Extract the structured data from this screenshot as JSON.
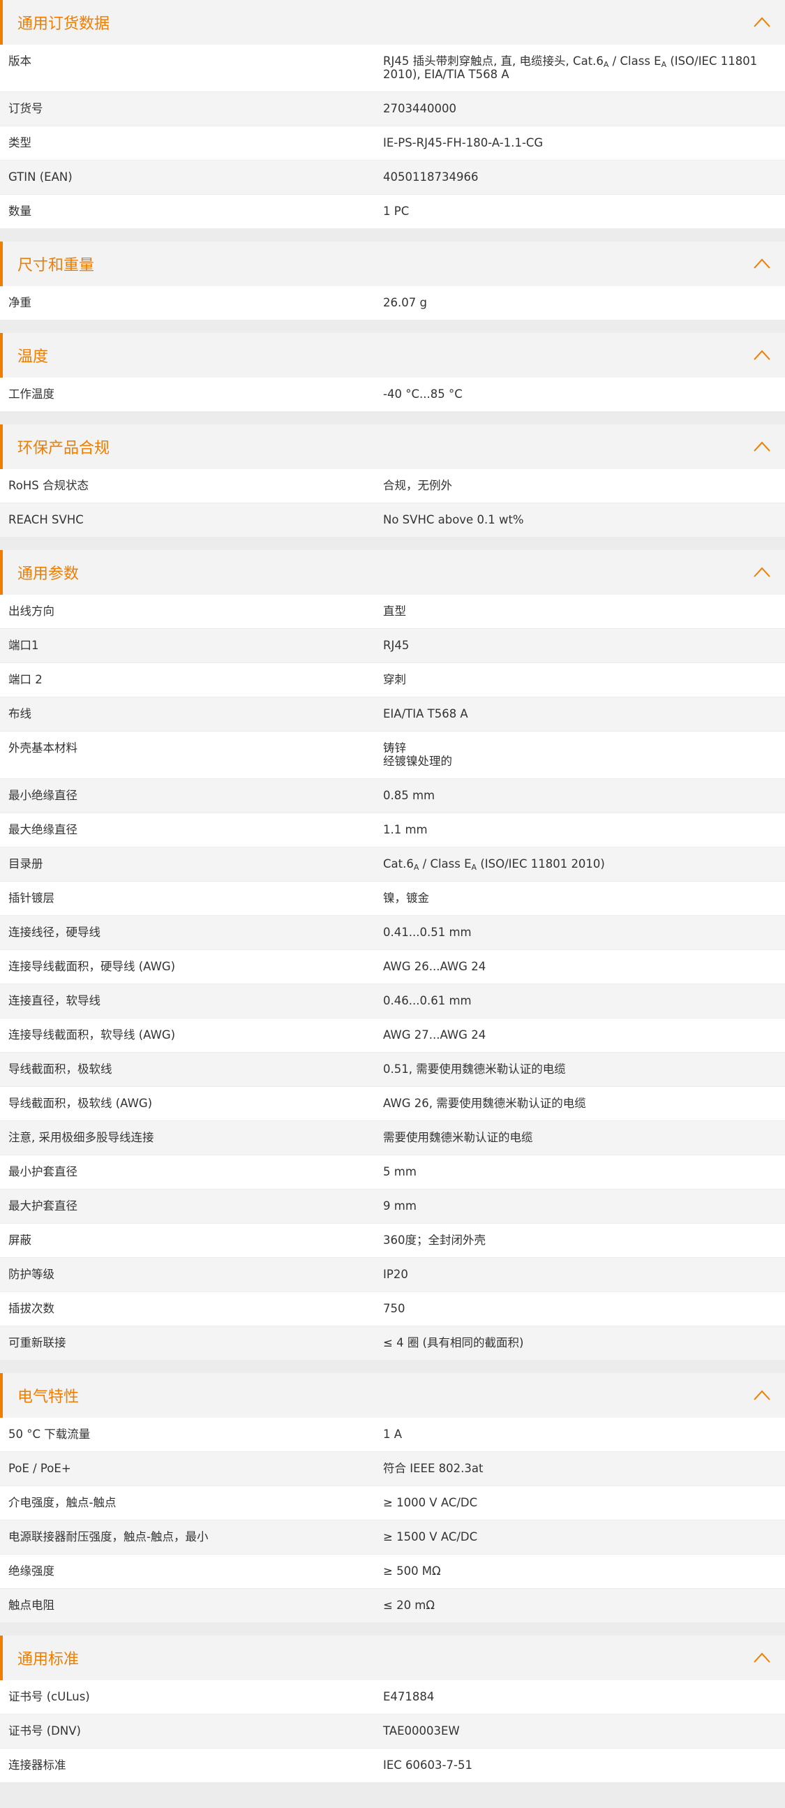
{
  "accent_color": "#f07d00",
  "collapse_icon": "chevron-up-icon",
  "sections": [
    {
      "id": "general-order",
      "title": "通用订货数据",
      "rows": [
        {
          "label": "版本",
          "value": "RJ45 插头带刺穿触点, 直, 电缆接头, Cat.6A / Class EA (ISO/IEC 11801 2010), EIA/TIA T568 A"
        },
        {
          "label": "订货号",
          "value": "2703440000"
        },
        {
          "label": "类型",
          "value": "IE-PS-RJ45-FH-180-A-1.1-CG"
        },
        {
          "label": "GTIN (EAN)",
          "value": "4050118734966"
        },
        {
          "label": "数量",
          "value": "1  PC"
        }
      ]
    },
    {
      "id": "dimensions",
      "title": "尺寸和重量",
      "rows": [
        {
          "label": "净重",
          "value": "26.07  g"
        }
      ]
    },
    {
      "id": "temperature",
      "title": "温度",
      "rows": [
        {
          "label": "工作温度",
          "value": "-40 °C...85 °C"
        }
      ]
    },
    {
      "id": "compliance",
      "title": "环保产品合规",
      "rows": [
        {
          "label": "RoHS 合规状态",
          "value": "合规，无例外"
        },
        {
          "label": "REACH SVHC",
          "value": "No SVHC above 0.1 wt%"
        }
      ]
    },
    {
      "id": "general-params",
      "title": "通用参数",
      "rows": [
        {
          "label": "出线方向",
          "value": "直型"
        },
        {
          "label": "端口1",
          "value": "RJ45"
        },
        {
          "label": "端口 2",
          "value": "穿刺"
        },
        {
          "label": "布线",
          "value": "EIA/TIA T568 A"
        },
        {
          "label": "外壳基本材料",
          "value": "铸锌\n经镀镍处理的"
        },
        {
          "label": "最小绝缘直径",
          "value": "0.85  mm"
        },
        {
          "label": "最大绝缘直径",
          "value": "1.1  mm"
        },
        {
          "label": "目录册",
          "value": "Cat.6A / Class EA (ISO/IEC 11801 2010)"
        },
        {
          "label": "插针镀层",
          "value": "镍，镀金"
        },
        {
          "label": "连接线径，硬导线",
          "value": "0.41...0.51 mm"
        },
        {
          "label": "连接导线截面积，硬导线 (AWG)",
          "value": "AWG 26...AWG 24"
        },
        {
          "label": "连接直径，软导线",
          "value": "0.46...0.61 mm"
        },
        {
          "label": "连接导线截面积，软导线 (AWG)",
          "value": "AWG 27...AWG 24"
        },
        {
          "label": "导线截面积，极软线",
          "value": "0.51, 需要使用魏德米勒认证的电缆"
        },
        {
          "label": "导线截面积，极软线 (AWG)",
          "value": "AWG 26, 需要使用魏德米勒认证的电缆"
        },
        {
          "label": "注意, 采用极细多股导线连接",
          "value": "需要使用魏德米勒认证的电缆"
        },
        {
          "label": "最小护套直径",
          "value": "5  mm"
        },
        {
          "label": "最大护套直径",
          "value": "9  mm"
        },
        {
          "label": "屏蔽",
          "value": "360度；全封闭外壳"
        },
        {
          "label": "防护等级",
          "value": "IP20"
        },
        {
          "label": "插拔次数",
          "value": "750"
        },
        {
          "label": "可重新联接",
          "value": "≤ 4 圈 (具有相同的截面积)"
        }
      ]
    },
    {
      "id": "electrical",
      "title": "电气特性",
      "rows": [
        {
          "label": "50 °C 下载流量",
          "value": "1  A"
        },
        {
          "label": "PoE / PoE+",
          "value": "符合 IEEE 802.3at"
        },
        {
          "label": "介电强度，触点-触点",
          "value": "≥ 1000 V AC/DC"
        },
        {
          "label": "电源联接器耐压强度，触点-触点，最小",
          "value": "≥ 1500 V AC/DC"
        },
        {
          "label": "绝缘强度",
          "value": "≥ 500 MΩ"
        },
        {
          "label": "触点电阻",
          "value": "≤ 20 mΩ"
        }
      ]
    },
    {
      "id": "standards",
      "title": "通用标准",
      "rows": [
        {
          "label": "证书号 (cULus)",
          "value": "E471884"
        },
        {
          "label": "证书号 (DNV)",
          "value": "TAE00003EW"
        },
        {
          "label": "连接器标准",
          "value": "IEC 60603-7-51"
        }
      ]
    }
  ]
}
